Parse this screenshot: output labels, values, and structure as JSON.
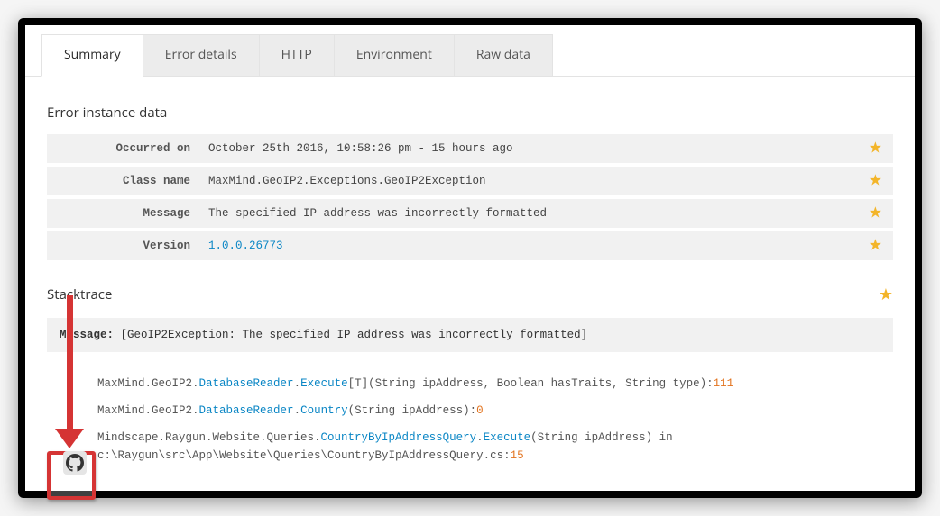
{
  "tabs": {
    "summary": "Summary",
    "errorDetails": "Error details",
    "http": "HTTP",
    "environment": "Environment",
    "rawData": "Raw data"
  },
  "section": {
    "instanceTitle": "Error instance data",
    "stacktraceTitle": "Stacktrace"
  },
  "rows": {
    "occurredLabel": "Occurred on",
    "occurredValue": "October 25th 2016, 10:58:26 pm - 15 hours ago",
    "classLabel": "Class name",
    "classValue": "MaxMind.GeoIP2.Exceptions.GeoIP2Exception",
    "messageLabel": "Message",
    "messageValue": "The specified IP address was incorrectly formatted",
    "versionLabel": "Version",
    "versionValue": "1.0.0.26773"
  },
  "stacktrace": {
    "messageLabel": "Message:",
    "messageText": " [GeoIP2Exception: The specified IP address was incorrectly formatted]",
    "line1a": "MaxMind.GeoIP2.",
    "line1b": "DatabaseReader",
    "line1c": ".",
    "line1d": "Execute",
    "line1e": "[T](String ipAddress, Boolean hasTraits, String type):",
    "line1num": "111",
    "line2a": "MaxMind.GeoIP2.",
    "line2b": "DatabaseReader",
    "line2c": ".",
    "line2d": "Country",
    "line2e": "(String ipAddress):",
    "line2num": "0",
    "line3a": "Mindscape.Raygun.Website.Queries.",
    "line3b": "CountryByIpAddressQuery",
    "line3c": ".",
    "line3d": "Execute",
    "line3e": "(String ipAddress) in ",
    "line3path": "c:\\Raygun\\src\\App\\Website\\Queries\\CountryByIpAddressQuery.cs:",
    "line3num": "15"
  },
  "icons": {
    "star": "★"
  }
}
